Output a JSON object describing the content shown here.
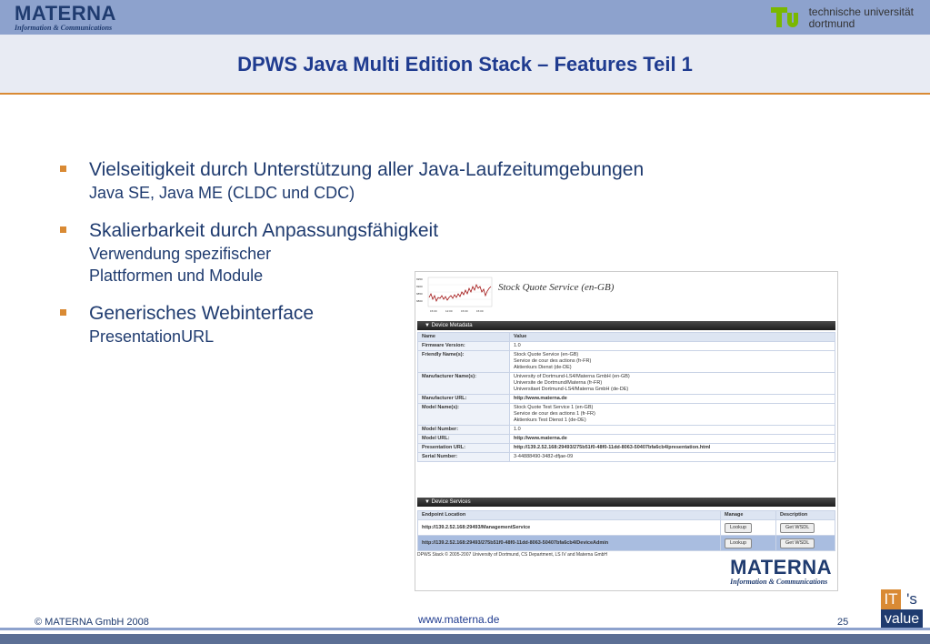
{
  "header": {
    "company": "MATERNA",
    "company_tagline": "Information & Communications",
    "university_line1": "technische universität",
    "university_line2": "dortmund"
  },
  "title": "DPWS Java Multi Edition Stack – Features Teil 1",
  "bullets": [
    {
      "main": "Vielseitigkeit durch Unterstützung aller Java-Laufzeitumgebungen",
      "sub": [
        "Java SE, Java ME (CLDC und CDC)"
      ]
    },
    {
      "main": "Skalierbarkeit durch Anpassungsfähigkeit",
      "sub": [
        "Verwendung spezifischer",
        "Plattformen und Module"
      ]
    },
    {
      "main": "Generisches Webinterface",
      "sub": [
        "PresentationURL"
      ]
    }
  ],
  "screenshot": {
    "service_title": "Stock Quote Service (en-GB)",
    "chart_y_ticks": [
      "6950",
      "6900",
      "6850",
      "6800"
    ],
    "chart_x_ticks": [
      "15:00",
      "12:00",
      "15:00",
      "15:00"
    ],
    "metadata_header": "Device Metadata",
    "col_name": "Name",
    "col_value": "Value",
    "rows": [
      {
        "k": "Firmware Version:",
        "v": [
          "1.0"
        ]
      },
      {
        "k": "Friendly Name(s):",
        "v": [
          "Stock Quote Service (en-GB)",
          "Service de cour des actions (fr-FR)",
          "Aktienkurs Dienst (de-DE)"
        ]
      },
      {
        "k": "Manufacturer Name(s):",
        "v": [
          "University of Dortmund-LS4/Materna GmbH (en-GB)",
          "Universite de Dortmund/Materna (fr-FR)",
          "Universitaet Dortmund-LS4/Materna GmbH (de-DE)"
        ]
      },
      {
        "k": "Manufacturer URL:",
        "v": [
          "http://www.materna.de"
        ]
      },
      {
        "k": "Model Name(s):",
        "v": [
          "Stock Quote Test Service 1 (en-GB)",
          "Service de cour des actions 1 (fr-FR)",
          "Aktienkurs Test Dienst 1 (de-DE)"
        ]
      },
      {
        "k": "Model Number:",
        "v": [
          "1.0"
        ]
      },
      {
        "k": "Model URL:",
        "v": [
          "http://www.materna.de"
        ]
      },
      {
        "k": "Presentation URL:",
        "v": [
          "http://139.2.52.168:29493/275b51f0-48f0-11dd-8063-50407bfa6cb4/presentation.html"
        ]
      },
      {
        "k": "Serial Number:",
        "v": [
          "3-44888490-3482-dfjae-09"
        ]
      }
    ],
    "services_header": "Device Services",
    "svc_col_endpoint": "Endpoint Location",
    "svc_col_manage": "Manage",
    "svc_col_desc": "Description",
    "services": [
      {
        "endpoint": "http://139.2.52.168:29493/ManagementService",
        "manage": "Lookup",
        "desc": "Get WSDL"
      },
      {
        "endpoint": "http://139.2.52.168:29493/275b51f0-48f0-11dd-8063-50407bfa6cb4/DeviceAdmin",
        "manage": "Lookup",
        "desc": "Get WSDL"
      }
    ],
    "copyright": "DPWS Stack © 2005-2007 University of Dortmund, CS Department, LS IV and Materna GmbH",
    "logo": "MATERNA",
    "logo_tagline": "Information & Communications"
  },
  "footer": {
    "copyright": "© MATERNA GmbH 2008",
    "url": "www.materna.de",
    "page": "25",
    "badge_it": "IT",
    "badge_s": "'s",
    "badge_value": "value"
  }
}
